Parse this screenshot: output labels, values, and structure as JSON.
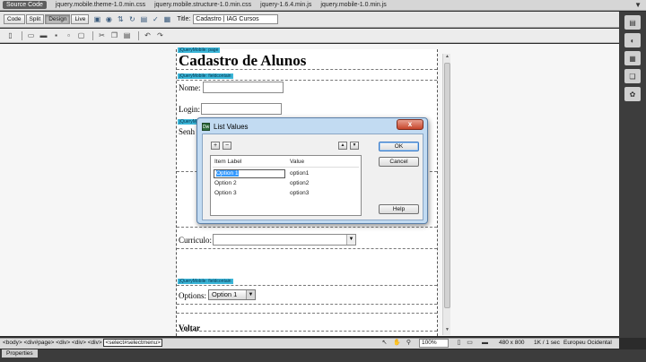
{
  "related_files": {
    "source_label": "Source Code",
    "files": [
      "jquery.mobile.theme-1.0.min.css",
      "jquery.mobile.structure-1.0.min.css",
      "jquery-1.6.4.min.js",
      "jquery.mobile-1.0.min.js"
    ]
  },
  "document_toolbar": {
    "views": [
      "Code",
      "Split",
      "Design",
      "Live"
    ],
    "active_view": "Design",
    "title_label": "Title:",
    "title_value": "Cadastro | IAG Cursos"
  },
  "page": {
    "tag_page": "jQueryMobile: page",
    "tag_fieldcontain": "jQueryMobile: fieldcontain",
    "tag_partial": "jQueryMo",
    "heading": "Cadastro de Alunos",
    "labels": {
      "nome": "Nome:",
      "login": "Login:",
      "senha": "Senh",
      "curriculo": "Curriculo:",
      "options": "Options:",
      "voltar": "Voltar"
    },
    "options_select_value": "Option 1"
  },
  "dialog": {
    "title": "List Values",
    "add": "+",
    "remove": "−",
    "up": "▲",
    "down": "▼",
    "columns": [
      "Item Label",
      "Value"
    ],
    "rows": [
      {
        "label": "Option 1",
        "value": "option1"
      },
      {
        "label": "Option 2",
        "value": "option2"
      },
      {
        "label": "Option 3",
        "value": "option3"
      }
    ],
    "ok": "OK",
    "cancel": "Cancel",
    "help": "Help",
    "close": "x"
  },
  "status_bar": {
    "crumbs": [
      "<body>",
      "<div#page>",
      "<div>",
      "<div>",
      "<div>",
      "<select#selectmenu>"
    ],
    "zoom": "100%",
    "dimensions": "480 x 800",
    "size_time": "1K / 1 sec",
    "encoding": "Europeu Ocidental"
  },
  "properties": {
    "label": "Properties"
  }
}
